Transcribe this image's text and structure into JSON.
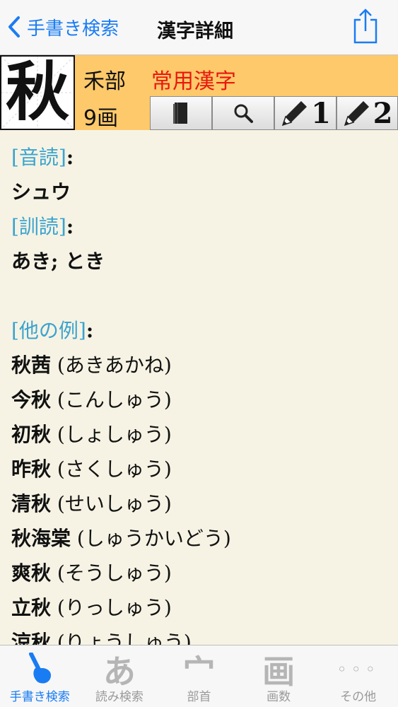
{
  "nav": {
    "back_label": "手書き検索",
    "title": "漢字詳細"
  },
  "kanji": {
    "character": "秋",
    "radical": "禾部",
    "grade": "常用漢字",
    "strokes": "9画"
  },
  "tools": [
    {
      "icon": "book-icon"
    },
    {
      "icon": "search-icon"
    },
    {
      "icon": "pencil-icon",
      "number": "1"
    },
    {
      "icon": "pencil-icon",
      "number": "2"
    }
  ],
  "readings": {
    "on_label": "[音読]",
    "on_value": "シュウ",
    "kun_label": "[訓読]",
    "kun_value": "あき; とき",
    "colon": ":"
  },
  "examples": {
    "label": "[他の例]",
    "items": [
      {
        "word": "秋茜",
        "reading": " (あきあかね)"
      },
      {
        "word": "今秋",
        "reading": " (こんしゅう)"
      },
      {
        "word": "初秋",
        "reading": " (しょしゅう)"
      },
      {
        "word": "昨秋",
        "reading": " (さくしゅう)"
      },
      {
        "word": "清秋",
        "reading": " (せいしゅう)"
      },
      {
        "word": "秋海棠",
        "reading": " (しゅうかいどう)"
      },
      {
        "word": "爽秋",
        "reading": " (そうしゅう)"
      },
      {
        "word": "立秋",
        "reading": " (りっしゅう)"
      },
      {
        "word": "涼秋",
        "reading": " (りょうしゅう)"
      }
    ]
  },
  "tabbar": {
    "tabs": [
      {
        "label": "手書き検索",
        "icon": "handwriting-icon",
        "active": true
      },
      {
        "label": "読み検索",
        "icon": "hiragana-a-icon",
        "glyph": "あ"
      },
      {
        "label": "部首",
        "icon": "radical-icon",
        "glyph": "宀"
      },
      {
        "label": "画数",
        "icon": "stroke-count-icon",
        "glyph": "画"
      },
      {
        "label": "その他",
        "icon": "more-icon",
        "glyph": "◦◦◦"
      }
    ]
  },
  "colors": {
    "accent": "#1a7cf2",
    "header_bg": "#fdc96a",
    "label": "#3ba3cf",
    "jouyou": "#e8180f",
    "content_bg": "#f6f3e4"
  }
}
